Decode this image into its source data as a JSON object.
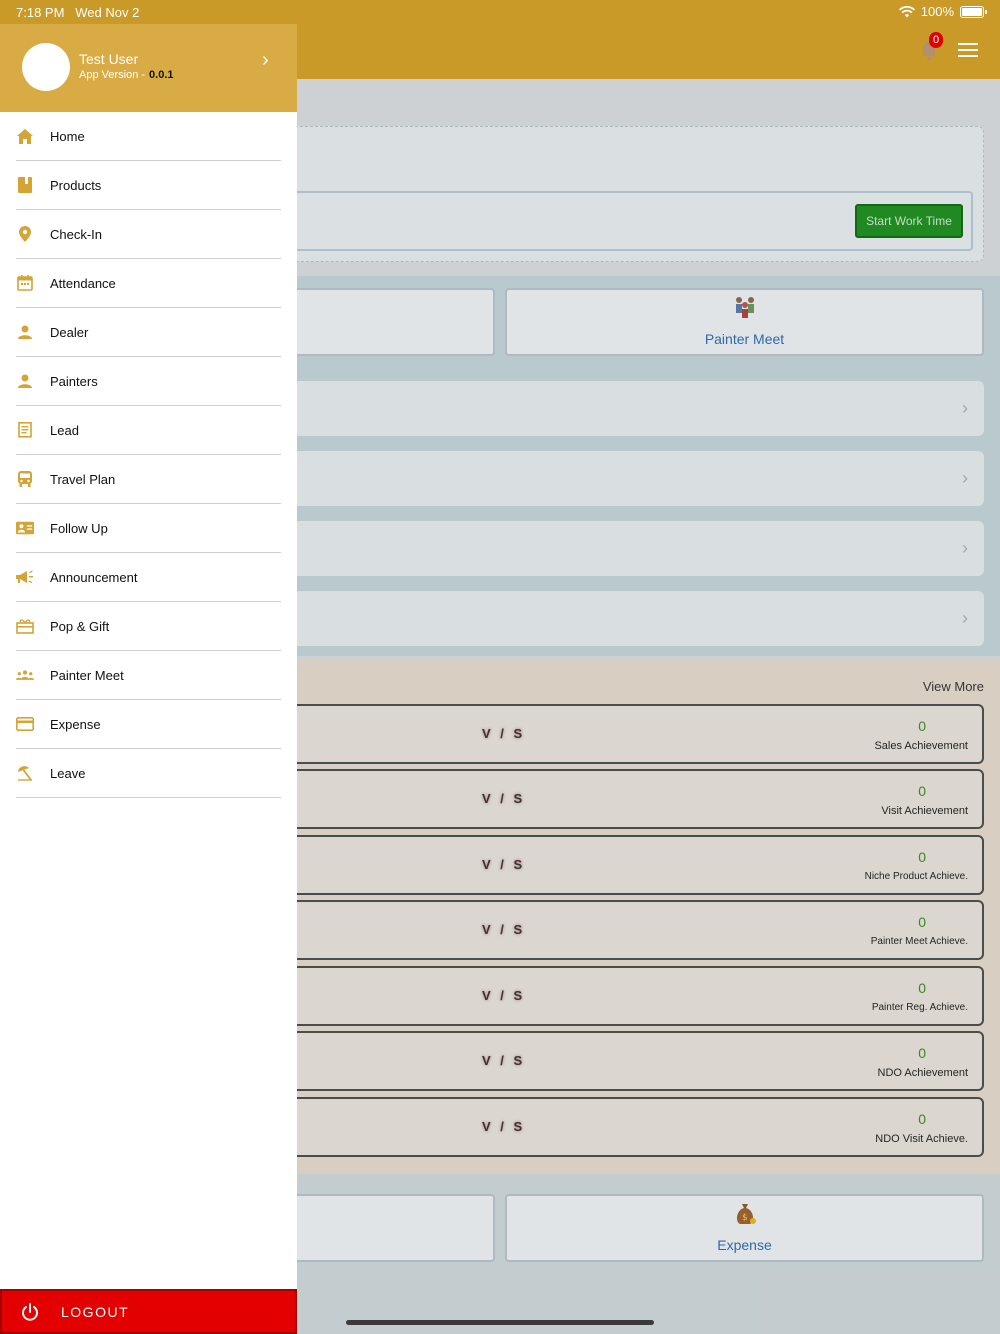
{
  "status_bar": {
    "time": "7:18 PM",
    "date": "Wed Nov 2",
    "battery": "100%"
  },
  "drawer": {
    "user_name": "Test User",
    "app_version_label": "App Version -",
    "app_version": "0.0.1",
    "items": [
      {
        "label": "Home",
        "icon": "home-icon"
      },
      {
        "label": "Products",
        "icon": "book-icon"
      },
      {
        "label": "Check-In",
        "icon": "map-pin-icon"
      },
      {
        "label": "Attendance",
        "icon": "calendar-icon"
      },
      {
        "label": "Dealer",
        "icon": "person-icon"
      },
      {
        "label": "Painters",
        "icon": "person-icon"
      },
      {
        "label": "Lead",
        "icon": "document-icon"
      },
      {
        "label": "Travel Plan",
        "icon": "bus-icon"
      },
      {
        "label": "Follow Up",
        "icon": "contact-card-icon"
      },
      {
        "label": "Announcement",
        "icon": "megaphone-icon"
      },
      {
        "label": "Pop & Gift",
        "icon": "gift-icon"
      },
      {
        "label": "Painter Meet",
        "icon": "group-icon"
      },
      {
        "label": "Expense",
        "icon": "credit-card-icon"
      },
      {
        "label": "Leave",
        "icon": "beach-umbrella-icon"
      }
    ],
    "logout_label": "LOGOUT"
  },
  "header": {
    "notification_count": "0"
  },
  "work": {
    "start_label": "Start Work Time"
  },
  "tiles": {
    "painter_meet": "Painter Meet",
    "expense": "Expense"
  },
  "achievements": {
    "view_more": "View More",
    "vs_label": "V / S",
    "items": [
      {
        "value": "0",
        "label": "Sales Achievement"
      },
      {
        "value": "0",
        "label": "Visit Achievement"
      },
      {
        "value": "0",
        "label": "Niche Product Achieve."
      },
      {
        "value": "0",
        "label": "Painter Meet Achieve."
      },
      {
        "value": "0",
        "label": "Painter Reg. Achieve."
      },
      {
        "value": "0",
        "label": "NDO Achievement"
      },
      {
        "value": "0",
        "label": "NDO Visit Achieve."
      }
    ]
  },
  "colors": {
    "brand": "#c99a27",
    "drawer_header": "#d9ab45",
    "logout": "#e30000",
    "achievement_value": "#3b8c1e",
    "tile_label": "#2d6cb0"
  }
}
